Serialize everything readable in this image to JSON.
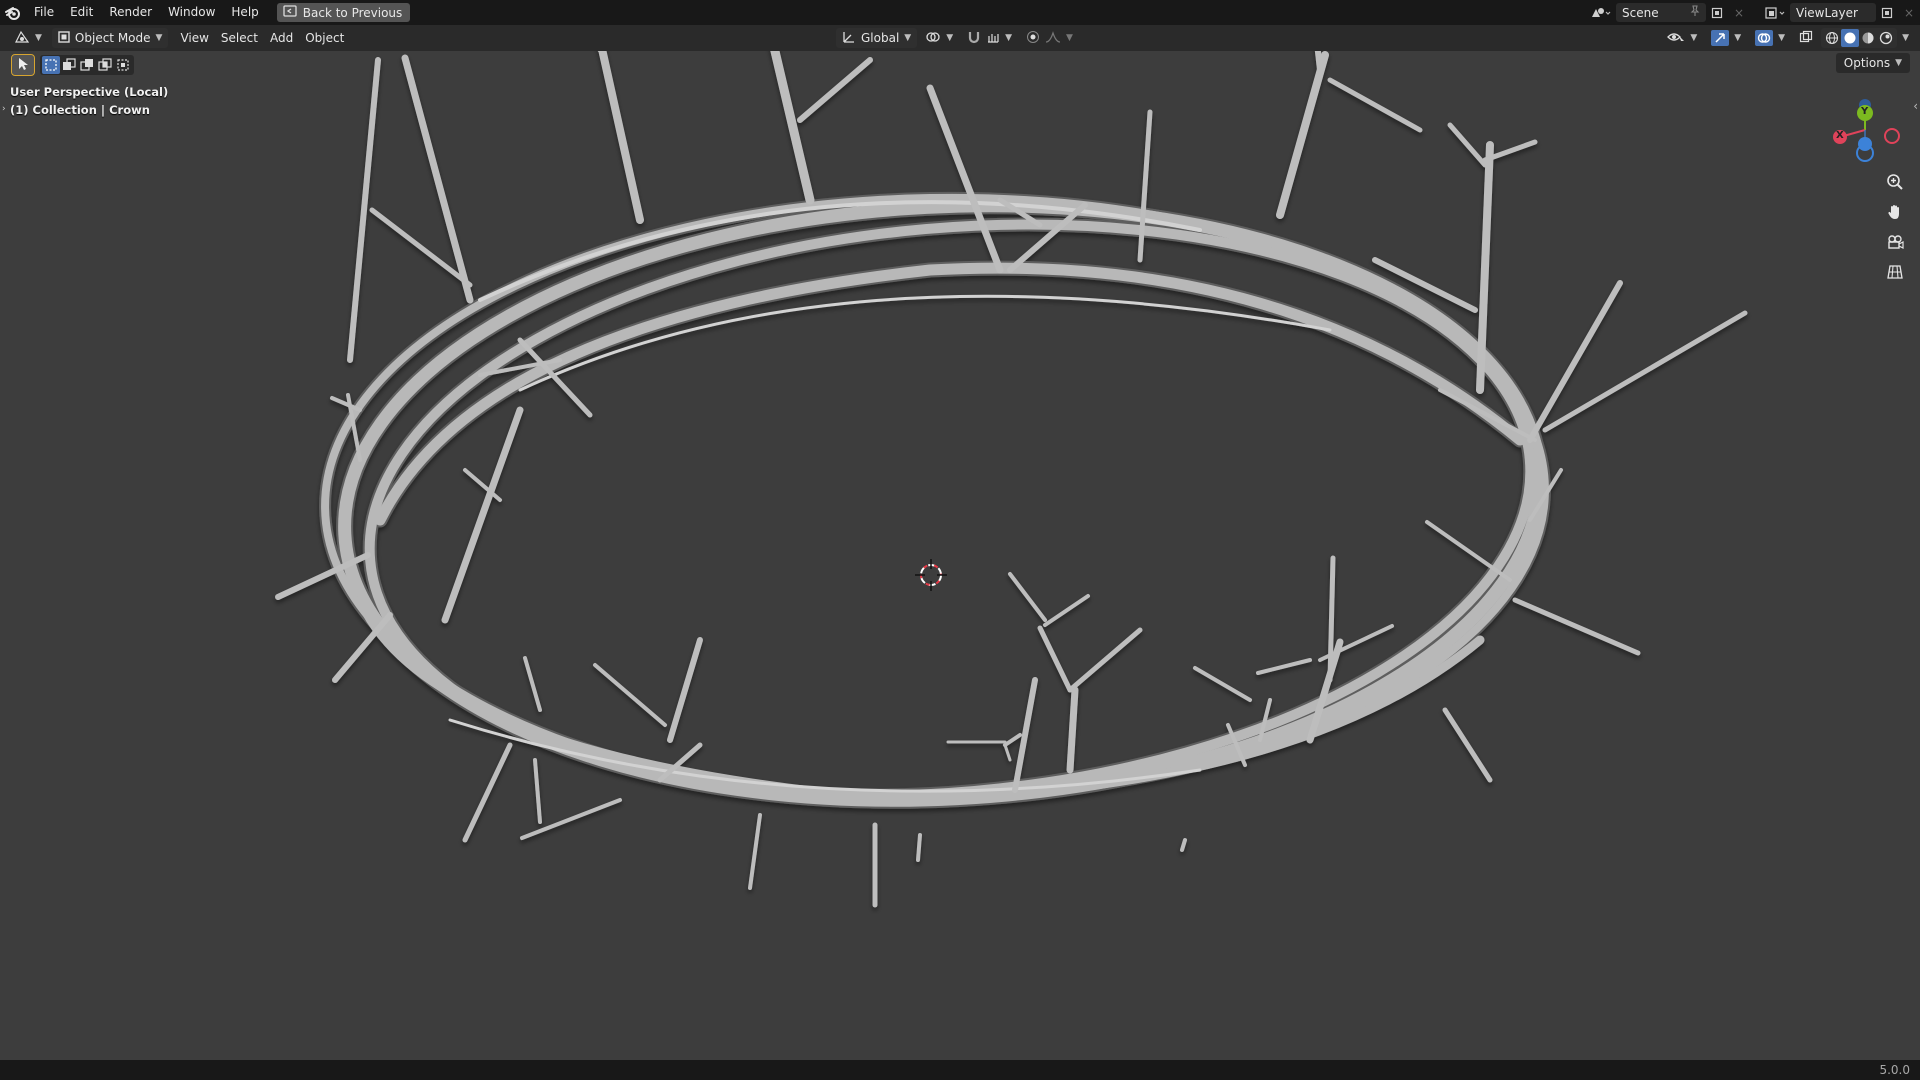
{
  "topbar": {
    "menus": [
      "File",
      "Edit",
      "Render",
      "Window",
      "Help"
    ],
    "back_label": "Back to Previous",
    "scene_name": "Scene",
    "viewlayer_name": "ViewLayer"
  },
  "header": {
    "mode_label": "Object Mode",
    "menus": [
      "View",
      "Select",
      "Add",
      "Object"
    ],
    "orientation_label": "Global"
  },
  "viewport": {
    "options_label": "Options",
    "perspective_label": "User Perspective (Local)",
    "collection_label": "(1) Collection | Crown",
    "gizmo": {
      "x_label": "X",
      "y_label": "Y"
    }
  },
  "statusbar": {
    "version": "5.0.0"
  },
  "colors": {
    "accent": "#4772b3",
    "axis_x": "#e0435a",
    "axis_y": "#7cba20",
    "axis_z": "#3c82d8",
    "active_tool": "#d7a530"
  }
}
